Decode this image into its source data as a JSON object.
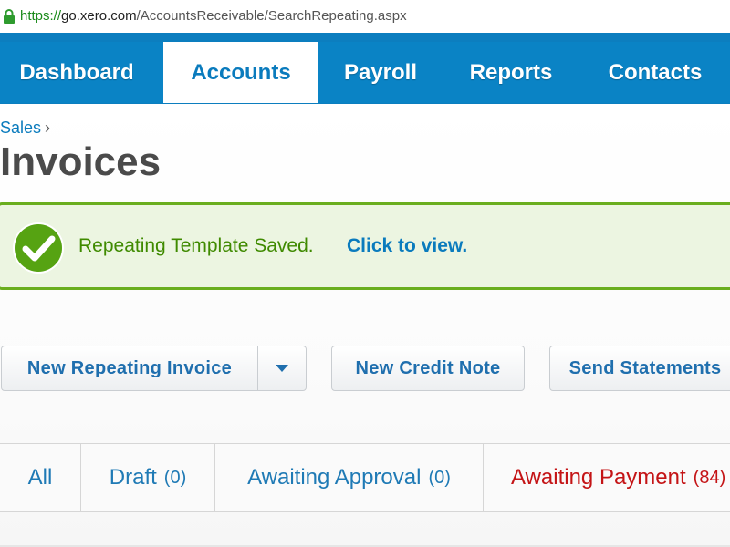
{
  "browser": {
    "url_protocol": "https://",
    "url_host": "go.xero.com",
    "url_path": "/AccountsReceivable/SearchRepeating.aspx"
  },
  "nav": {
    "tabs": [
      {
        "label": "Dashboard",
        "active": false
      },
      {
        "label": "Accounts",
        "active": true
      },
      {
        "label": "Payroll",
        "active": false
      },
      {
        "label": "Reports",
        "active": false
      },
      {
        "label": "Contacts",
        "active": false
      }
    ]
  },
  "breadcrumb": {
    "parent": "Sales",
    "separator": "›"
  },
  "page": {
    "title": "Invoices"
  },
  "banner": {
    "message": "Repeating Template Saved.",
    "link": "Click to view.",
    "icon": "check-circle-icon"
  },
  "actions": {
    "new_repeating_invoice": "New Repeating Invoice",
    "new_credit_note": "New Credit Note",
    "send_statements": "Send Statements"
  },
  "status_tabs": [
    {
      "label": "All",
      "count": ""
    },
    {
      "label": "Draft",
      "count": "(0)"
    },
    {
      "label": "Awaiting Approval",
      "count": "(0)"
    },
    {
      "label": "Awaiting Payment",
      "count": "(84)"
    }
  ],
  "colors": {
    "brand_blue": "#0a83c5",
    "success_green": "#6aae1e",
    "alert_red": "#c41416"
  }
}
